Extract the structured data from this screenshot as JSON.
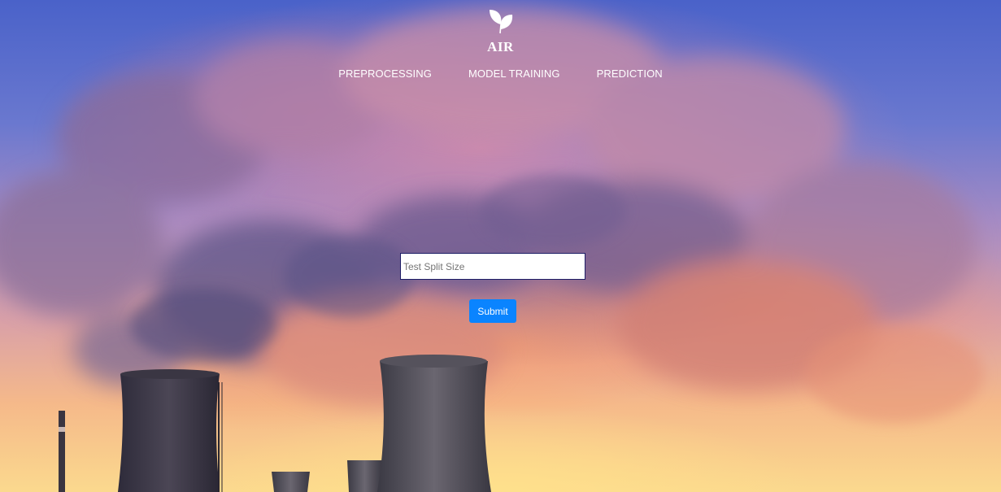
{
  "brand": {
    "name": "AIR",
    "icon": "leaf-icon"
  },
  "nav": {
    "items": [
      {
        "label": "PREPROCESSING"
      },
      {
        "label": "MODEL TRAINING"
      },
      {
        "label": "PREDICTION"
      }
    ]
  },
  "form": {
    "test_split": {
      "value": "",
      "placeholder": "Test Split Size"
    },
    "submit_label": "Submit"
  },
  "colors": {
    "accent": "#0a84ff",
    "nav_text": "#ffffff",
    "input_border": "#1d1d66"
  }
}
